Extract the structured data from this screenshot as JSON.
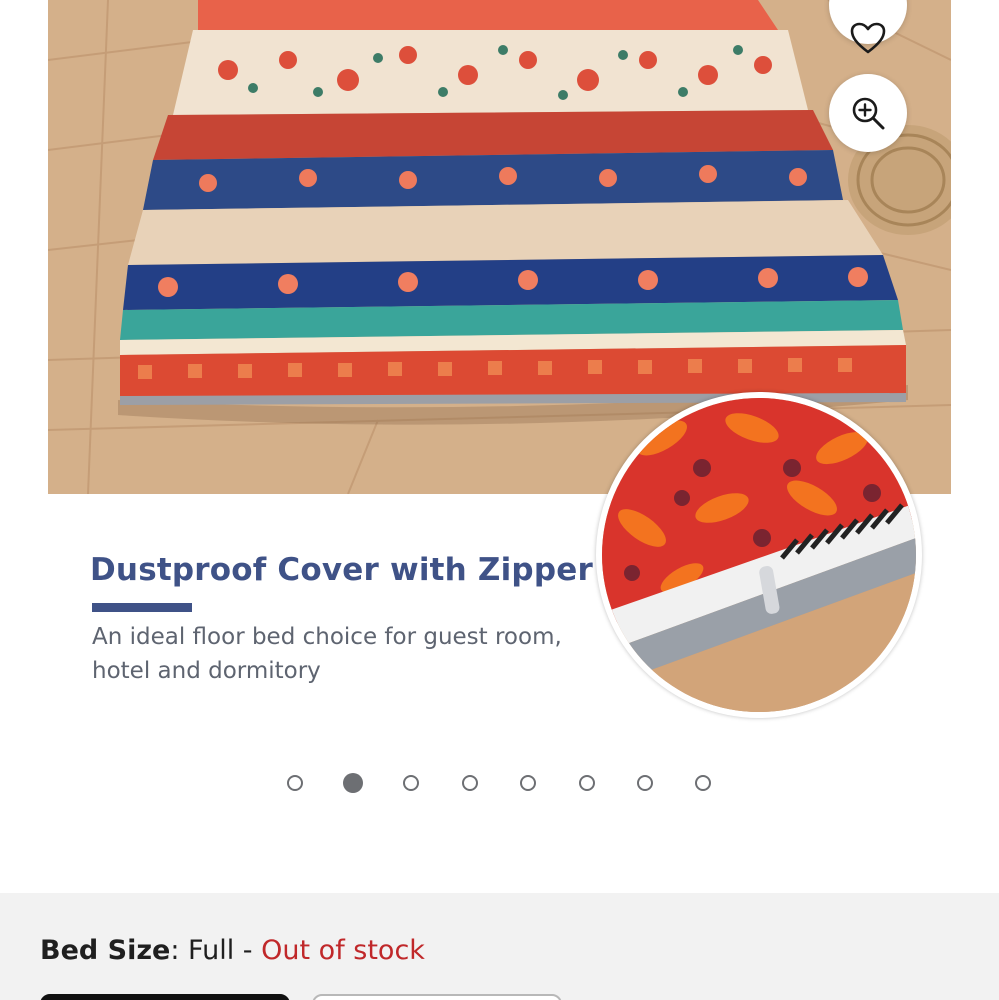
{
  "gallery": {
    "promo_title": "Dustproof Cover with Zipper",
    "promo_description": "An ideal floor bed choice for guest room, hotel and dormitory",
    "favorite_icon": "heart-icon",
    "zoom_icon": "zoom-in-icon",
    "slide_count": 8,
    "active_slide": 2
  },
  "variant": {
    "label": "Bed Size",
    "separator": ": ",
    "selected_value": "Full",
    "dash": " - ",
    "availability": "Out of stock"
  },
  "colors": {
    "brand_title": "#3f5287",
    "out_of_stock": "#c0282a",
    "dot": "#6d6f73",
    "section_bg": "#f2f2f2"
  }
}
